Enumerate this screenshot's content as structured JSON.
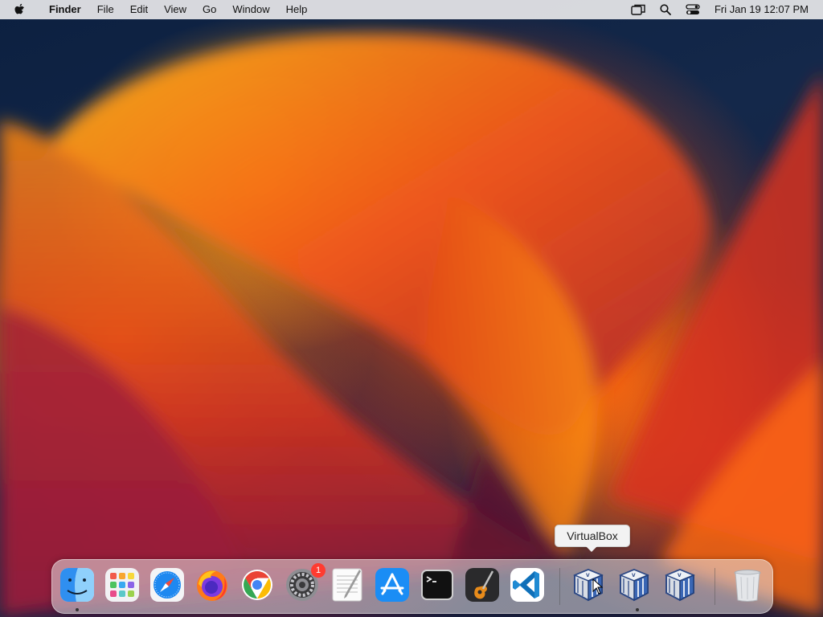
{
  "menubar": {
    "app_name": "Finder",
    "menus": [
      "File",
      "Edit",
      "View",
      "Go",
      "Window",
      "Help"
    ],
    "clock": "Fri Jan 19  12:07 PM"
  },
  "tooltip": {
    "label": "VirtualBox"
  },
  "dock": {
    "settings_badge": "1",
    "items": [
      {
        "name": "Finder",
        "icon": "finder-icon",
        "running": true
      },
      {
        "name": "Launchpad",
        "icon": "launchpad-icon",
        "running": false
      },
      {
        "name": "Safari",
        "icon": "safari-icon",
        "running": false
      },
      {
        "name": "Firefox",
        "icon": "firefox-icon",
        "running": false
      },
      {
        "name": "Google Chrome",
        "icon": "chrome-icon",
        "running": false
      },
      {
        "name": "System Settings",
        "icon": "system-settings-icon",
        "running": false
      },
      {
        "name": "TextEdit",
        "icon": "textedit-icon",
        "running": false
      },
      {
        "name": "App Store",
        "icon": "app-store-icon",
        "running": false
      },
      {
        "name": "Terminal",
        "icon": "terminal-icon",
        "running": false
      },
      {
        "name": "GarageBand",
        "icon": "garageband-icon",
        "running": false
      },
      {
        "name": "Visual Studio Code",
        "icon": "vscode-icon",
        "running": false
      },
      {
        "name": "VirtualBox",
        "icon": "virtualbox-icon",
        "running": false
      },
      {
        "name": "VirtualBox",
        "icon": "virtualbox-icon",
        "running": true
      },
      {
        "name": "VirtualBox",
        "icon": "virtualbox-icon",
        "running": false
      },
      {
        "name": "Trash",
        "icon": "trash-icon",
        "running": false
      }
    ]
  },
  "colors": {
    "menubar_bg": "#e8e8ea",
    "badge": "#ff3b30",
    "wallpaper_orange": "#ff8a0f",
    "wallpaper_navy": "#0c2040"
  }
}
